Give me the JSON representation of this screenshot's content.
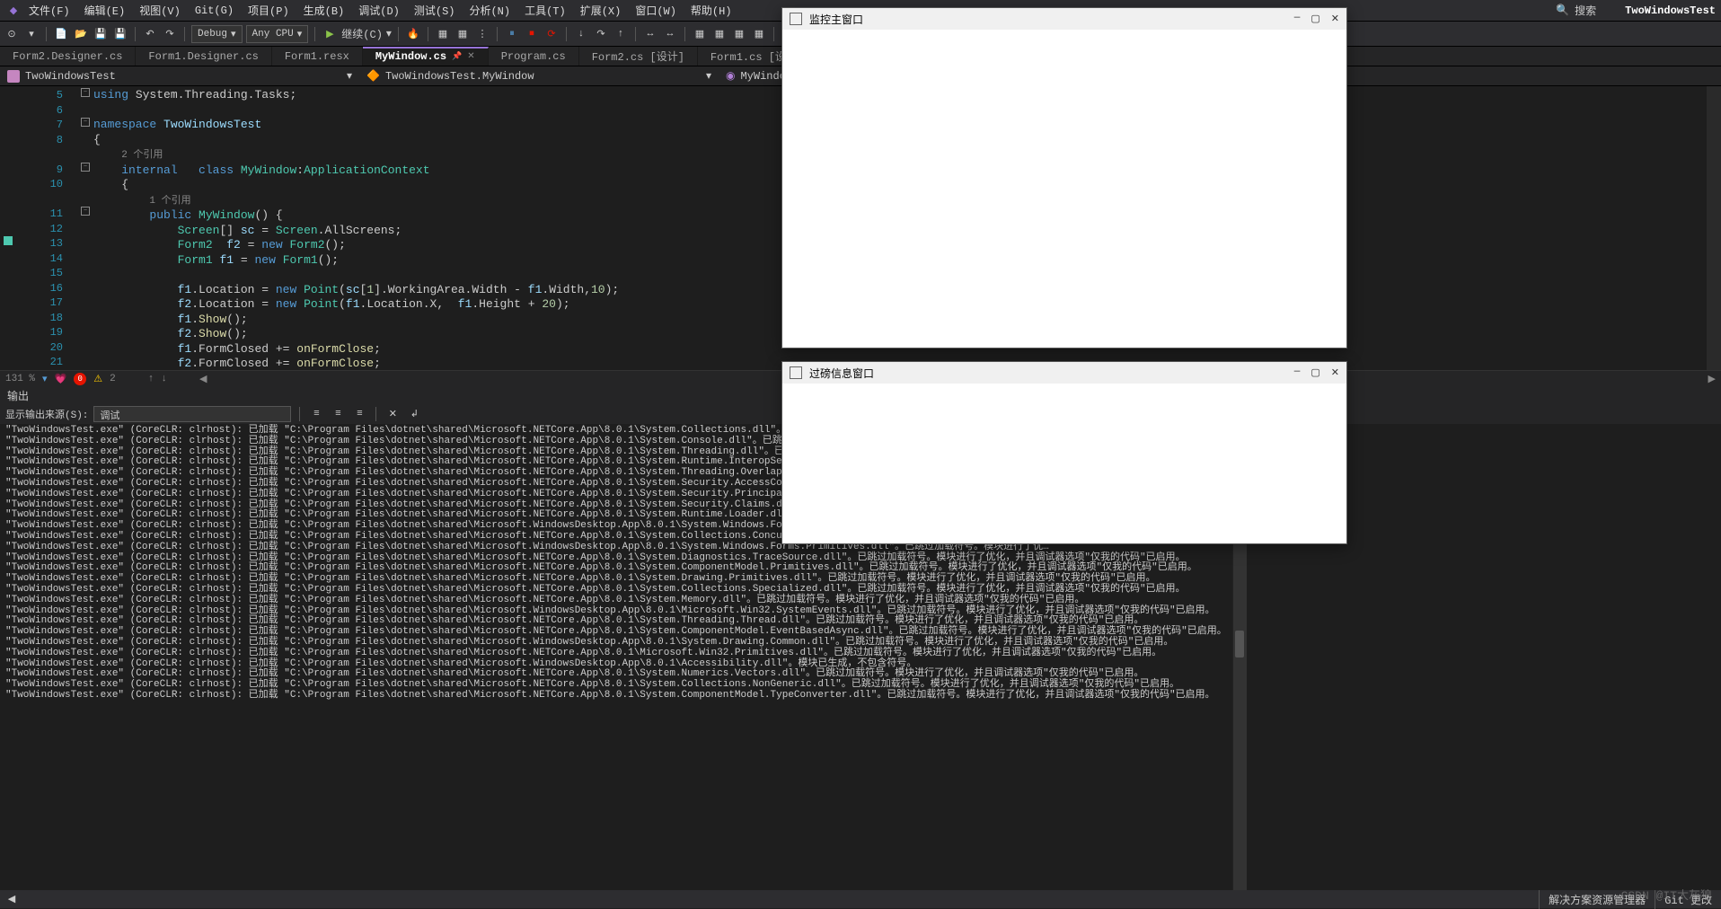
{
  "menu": {
    "items": [
      "文件(F)",
      "编辑(E)",
      "视图(V)",
      "Git(G)",
      "项目(P)",
      "生成(B)",
      "调试(D)",
      "测试(S)",
      "分析(N)",
      "工具(T)",
      "扩展(X)",
      "窗口(W)",
      "帮助(H)"
    ],
    "search_icon": "🔍",
    "search_label": "搜索",
    "project_title": "TwoWindowsTest"
  },
  "toolbar": {
    "config_dd": "Debug",
    "platform_dd": "Any CPU",
    "continue_label": "继续(C)"
  },
  "tabs": [
    {
      "label": "Form2.Designer.cs",
      "active": false
    },
    {
      "label": "Form1.Designer.cs",
      "active": false
    },
    {
      "label": "Form1.resx",
      "active": false
    },
    {
      "label": "MyWindow.cs",
      "active": true,
      "pinned": true
    },
    {
      "label": "Program.cs",
      "active": false
    },
    {
      "label": "Form2.cs [设计]",
      "active": false
    },
    {
      "label": "Form1.cs [设计]",
      "active": false
    }
  ],
  "nav": {
    "project": "TwoWindowsTest",
    "class": "TwoWindowsTest.MyWindow",
    "member": "MyWindo"
  },
  "edstatus": {
    "zoom": "131 %",
    "errors": "0",
    "warnings": "2"
  },
  "code": {
    "lines": [
      5,
      6,
      7,
      8,
      "",
      9,
      10,
      "",
      11,
      12,
      13,
      14,
      15,
      16,
      17,
      18,
      19,
      20,
      21
    ],
    "ref1": "2 个引用",
    "ref2": "1 个引用"
  },
  "output": {
    "title": "输出",
    "source_label": "显示输出来源(S):",
    "source_value": "调试",
    "lines": [
      "\"TwoWindowsTest.exe\" (CoreCLR: clrhost): 已加载 \"C:\\Program Files\\dotnet\\shared\\Microsoft.NETCore.App\\8.0.1\\System.Collections.dll\"。已跳过加载符号。模块进行了优化，并且调试器选项…",
      "\"TwoWindowsTest.exe\" (CoreCLR: clrhost): 已加载 \"C:\\Program Files\\dotnet\\shared\\Microsoft.NETCore.App\\8.0.1\\System.Console.dll\"。已跳过加载符号。模块进行了优化，并且调试器选项\"仅我…",
      "\"TwoWindowsTest.exe\" (CoreCLR: clrhost): 已加载 \"C:\\Program Files\\dotnet\\shared\\Microsoft.NETCore.App\\8.0.1\\System.Threading.dll\"。已跳过加载符号。模块进行了优化，并且调试器选项\"仅…",
      "\"TwoWindowsTest.exe\" (CoreCLR: clrhost): 已加载 \"C:\\Program Files\\dotnet\\shared\\Microsoft.NETCore.App\\8.0.1\\System.Runtime.InteropServices.dll\"。已跳过加载符号。模块进行了优化，并且…",
      "\"TwoWindowsTest.exe\" (CoreCLR: clrhost): 已加载 \"C:\\Program Files\\dotnet\\shared\\Microsoft.NETCore.App\\8.0.1\\System.Threading.Overlapped.dll\"。已跳过加载符号。模块进行了优化，并且调…",
      "\"TwoWindowsTest.exe\" (CoreCLR: clrhost): 已加载 \"C:\\Program Files\\dotnet\\shared\\Microsoft.NETCore.App\\8.0.1\\System.Security.AccessControl.dll\"。已跳过加载符号。模块进行了优化，并且…",
      "\"TwoWindowsTest.exe\" (CoreCLR: clrhost): 已加载 \"C:\\Program Files\\dotnet\\shared\\Microsoft.NETCore.App\\8.0.1\\System.Security.Principal.Windows.dll\"。已跳过加载符号。模块进行了优化，…",
      "\"TwoWindowsTest.exe\" (CoreCLR: clrhost): 已加载 \"C:\\Program Files\\dotnet\\shared\\Microsoft.NETCore.App\\8.0.1\\System.Security.Claims.dll\"。已跳过加载符号。模块进行了优化，并且调试器选…",
      "\"TwoWindowsTest.exe\" (CoreCLR: clrhost): 已加载 \"C:\\Program Files\\dotnet\\shared\\Microsoft.NETCore.App\\8.0.1\\System.Runtime.Loader.dll\"。已跳过加载符号。模块进行了优化，并且调试器选…",
      "\"TwoWindowsTest.exe\" (CoreCLR: clrhost): 已加载 \"C:\\Program Files\\dotnet\\shared\\Microsoft.WindowsDesktop.App\\8.0.1\\System.Windows.Forms.dll\"。已跳过加载符号。模块进行了优化，并且…",
      "\"TwoWindowsTest.exe\" (CoreCLR: clrhost): 已加载 \"C:\\Program Files\\dotnet\\shared\\Microsoft.NETCore.App\\8.0.1\\System.Collections.Concurrent.dll\"。已跳过加载符号。模块进行了优化，并且…",
      "\"TwoWindowsTest.exe\" (CoreCLR: clrhost): 已加载 \"C:\\Program Files\\dotnet\\shared\\Microsoft.WindowsDesktop.App\\8.0.1\\System.Windows.Forms.Primitives.dll\"。已跳过加载符号。模块进行了优…",
      "\"TwoWindowsTest.exe\" (CoreCLR: clrhost): 已加载 \"C:\\Program Files\\dotnet\\shared\\Microsoft.NETCore.App\\8.0.1\\System.Diagnostics.TraceSource.dll\"。已跳过加载符号。模块进行了优化，并且调试器选项\"仅我的代码\"已启用。",
      "\"TwoWindowsTest.exe\" (CoreCLR: clrhost): 已加载 \"C:\\Program Files\\dotnet\\shared\\Microsoft.NETCore.App\\8.0.1\\System.ComponentModel.Primitives.dll\"。已跳过加载符号。模块进行了优化，并且调试器选项\"仅我的代码\"已启用。",
      "\"TwoWindowsTest.exe\" (CoreCLR: clrhost): 已加载 \"C:\\Program Files\\dotnet\\shared\\Microsoft.NETCore.App\\8.0.1\\System.Drawing.Primitives.dll\"。已跳过加载符号。模块进行了优化，并且调试器选项\"仅我的代码\"已启用。",
      "\"TwoWindowsTest.exe\" (CoreCLR: clrhost): 已加载 \"C:\\Program Files\\dotnet\\shared\\Microsoft.NETCore.App\\8.0.1\\System.Collections.Specialized.dll\"。已跳过加载符号。模块进行了优化，并且调试器选项\"仅我的代码\"已启用。",
      "\"TwoWindowsTest.exe\" (CoreCLR: clrhost): 已加载 \"C:\\Program Files\\dotnet\\shared\\Microsoft.NETCore.App\\8.0.1\\System.Memory.dll\"。已跳过加载符号。模块进行了优化，并且调试器选项\"仅我的代码\"已启用。",
      "\"TwoWindowsTest.exe\" (CoreCLR: clrhost): 已加载 \"C:\\Program Files\\dotnet\\shared\\Microsoft.WindowsDesktop.App\\8.0.1\\Microsoft.Win32.SystemEvents.dll\"。已跳过加载符号。模块进行了优化，并且调试器选项\"仅我的代码\"已启用。",
      "\"TwoWindowsTest.exe\" (CoreCLR: clrhost): 已加载 \"C:\\Program Files\\dotnet\\shared\\Microsoft.NETCore.App\\8.0.1\\System.Threading.Thread.dll\"。已跳过加载符号。模块进行了优化，并且调试器选项\"仅我的代码\"已启用。",
      "\"TwoWindowsTest.exe\" (CoreCLR: clrhost): 已加载 \"C:\\Program Files\\dotnet\\shared\\Microsoft.NETCore.App\\8.0.1\\System.ComponentModel.EventBasedAsync.dll\"。已跳过加载符号。模块进行了优化，并且调试器选项\"仅我的代码\"已启用。",
      "\"TwoWindowsTest.exe\" (CoreCLR: clrhost): 已加载 \"C:\\Program Files\\dotnet\\shared\\Microsoft.WindowsDesktop.App\\8.0.1\\System.Drawing.Common.dll\"。已跳过加载符号。模块进行了优化，并且调试器选项\"仅我的代码\"已启用。",
      "\"TwoWindowsTest.exe\" (CoreCLR: clrhost): 已加载 \"C:\\Program Files\\dotnet\\shared\\Microsoft.NETCore.App\\8.0.1\\Microsoft.Win32.Primitives.dll\"。已跳过加载符号。模块进行了优化，并且调试器选项\"仅我的代码\"已启用。",
      "\"TwoWindowsTest.exe\" (CoreCLR: clrhost): 已加载 \"C:\\Program Files\\dotnet\\shared\\Microsoft.WindowsDesktop.App\\8.0.1\\Accessibility.dll\"。模块已生成，不包含符号。",
      "\"TwoWindowsTest.exe\" (CoreCLR: clrhost): 已加载 \"C:\\Program Files\\dotnet\\shared\\Microsoft.NETCore.App\\8.0.1\\System.Numerics.Vectors.dll\"。已跳过加载符号。模块进行了优化，并且调试器选项\"仅我的代码\"已启用。",
      "\"TwoWindowsTest.exe\" (CoreCLR: clrhost): 已加载 \"C:\\Program Files\\dotnet\\shared\\Microsoft.NETCore.App\\8.0.1\\System.Collections.NonGeneric.dll\"。已跳过加载符号。模块进行了优化，并且调试器选项\"仅我的代码\"已启用。",
      "\"TwoWindowsTest.exe\" (CoreCLR: clrhost): 已加载 \"C:\\Program Files\\dotnet\\shared\\Microsoft.NETCore.App\\8.0.1\\System.ComponentModel.TypeConverter.dll\"。已跳过加载符号。模块进行了优化，并且调试器选项\"仅我的代码\"已启用。"
    ]
  },
  "bottombar": {
    "solution": "解决方案资源管理器",
    "git": "Git 更改"
  },
  "watermark": "CSDN @IT大灰狼",
  "float1": {
    "title": "监控主窗口"
  },
  "float2": {
    "title": "过磅信息窗口"
  }
}
